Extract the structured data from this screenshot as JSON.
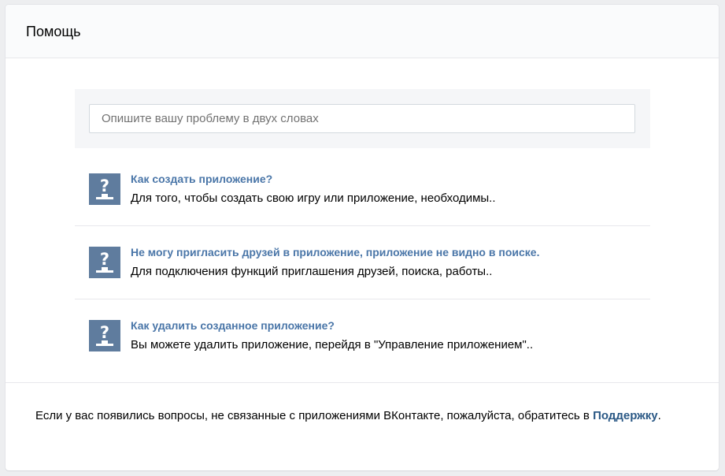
{
  "header": {
    "title": "Помощь"
  },
  "search": {
    "placeholder": "Опишите вашу проблему в двух словах",
    "value": ""
  },
  "faq": {
    "items": [
      {
        "title": "Как создать приложение?",
        "description": "Для того, чтобы создать свою игру или приложение, необходимы..",
        "icon": "question-icon"
      },
      {
        "title": "Не могу пригласить друзей в приложение, приложение не видно в поиске.",
        "description": "Для подключения функций приглашения друзей, поиска, работы..",
        "icon": "question-icon"
      },
      {
        "title": "Как удалить созданное приложение?",
        "description": "Вы можете удалить приложение, перейдя в \"Управление приложением\"..",
        "icon": "question-icon"
      }
    ]
  },
  "footer": {
    "text_before": "Если у вас появились вопросы, не связанные с приложениями ВКонтакте, пожалуйста, обратитесь в ",
    "link_label": "Поддержку",
    "text_after": "."
  },
  "colors": {
    "background": "#edeef0",
    "panel": "#ffffff",
    "header": "#fafbfc",
    "link": "#4a76a8",
    "support_link": "#2a5885",
    "icon_bg": "#5f7c9e"
  }
}
